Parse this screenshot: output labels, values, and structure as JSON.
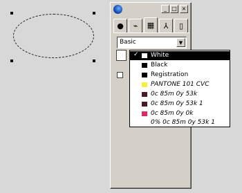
{
  "palette": {
    "titlebar": {
      "minimize_glyph": "_",
      "maximize_glyph": "□",
      "close_glyph": "×"
    },
    "tabs": [
      {
        "icon": "fill-tab-icon",
        "glyph": "●"
      },
      {
        "icon": "stroke-tab-icon",
        "glyph": "⌁"
      },
      {
        "icon": "swatches-tab-icon",
        "glyph": "▦"
      },
      {
        "icon": "brush-tab-icon",
        "glyph": "⅄"
      },
      {
        "icon": "page-tab-icon",
        "glyph": "▯"
      }
    ],
    "preset": {
      "value": "Basic",
      "arrow_glyph": "▼"
    }
  },
  "color_list": {
    "items": [
      {
        "label": "White",
        "color": "#ffffff",
        "checked": true,
        "selected": true,
        "checkmark": "✓"
      },
      {
        "label": "Black",
        "color": "#000000",
        "checked": false,
        "selected": false
      },
      {
        "label": "Registration",
        "color": "#000000",
        "checked": false,
        "selected": false
      },
      {
        "label": "PANTONE 101 CVC",
        "color": "#f4ef3a",
        "checked": false,
        "selected": false,
        "italic": true
      },
      {
        "label": "0c 85m 0y 53k",
        "color": "#4a1a2a",
        "checked": false,
        "selected": false,
        "italic": true
      },
      {
        "label": "0c 85m 0y 53k 1",
        "color": "#4a1a2a",
        "checked": false,
        "selected": false,
        "italic": true
      },
      {
        "label": "0c 85m 0y 0k",
        "color": "#e0296b",
        "checked": false,
        "selected": false,
        "italic": true
      },
      {
        "label": "0% 0c 85m 0y 53k 1",
        "color": "",
        "checked": false,
        "selected": false,
        "italic": true
      }
    ]
  }
}
